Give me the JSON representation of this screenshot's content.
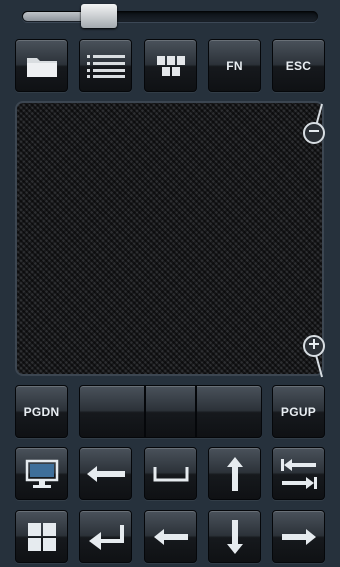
{
  "slider": {
    "value": 0.26
  },
  "toolbar": {
    "folder_icon": "folder-icon",
    "list_icon": "list-icon",
    "grid_icon": "keyboard-grid-icon",
    "fn_label": "FN",
    "esc_label": "ESC"
  },
  "touchpad": {
    "zoom_out_icon": "zoom-out-icon",
    "zoom_in_icon": "zoom-in-icon"
  },
  "nav": {
    "pgdn_label": "PGDN",
    "pgup_label": "PGUP"
  },
  "keys": {
    "row1": [
      "monitor-icon",
      "arrow-left-long-icon",
      "space-icon",
      "arrow-up-icon",
      "tab-icon"
    ],
    "row2": [
      "windows-icon",
      "enter-icon",
      "arrow-left-icon",
      "arrow-down-icon",
      "arrow-right-icon"
    ]
  },
  "colors": {
    "background": "#26313c",
    "button_text": "#e9eef2"
  }
}
